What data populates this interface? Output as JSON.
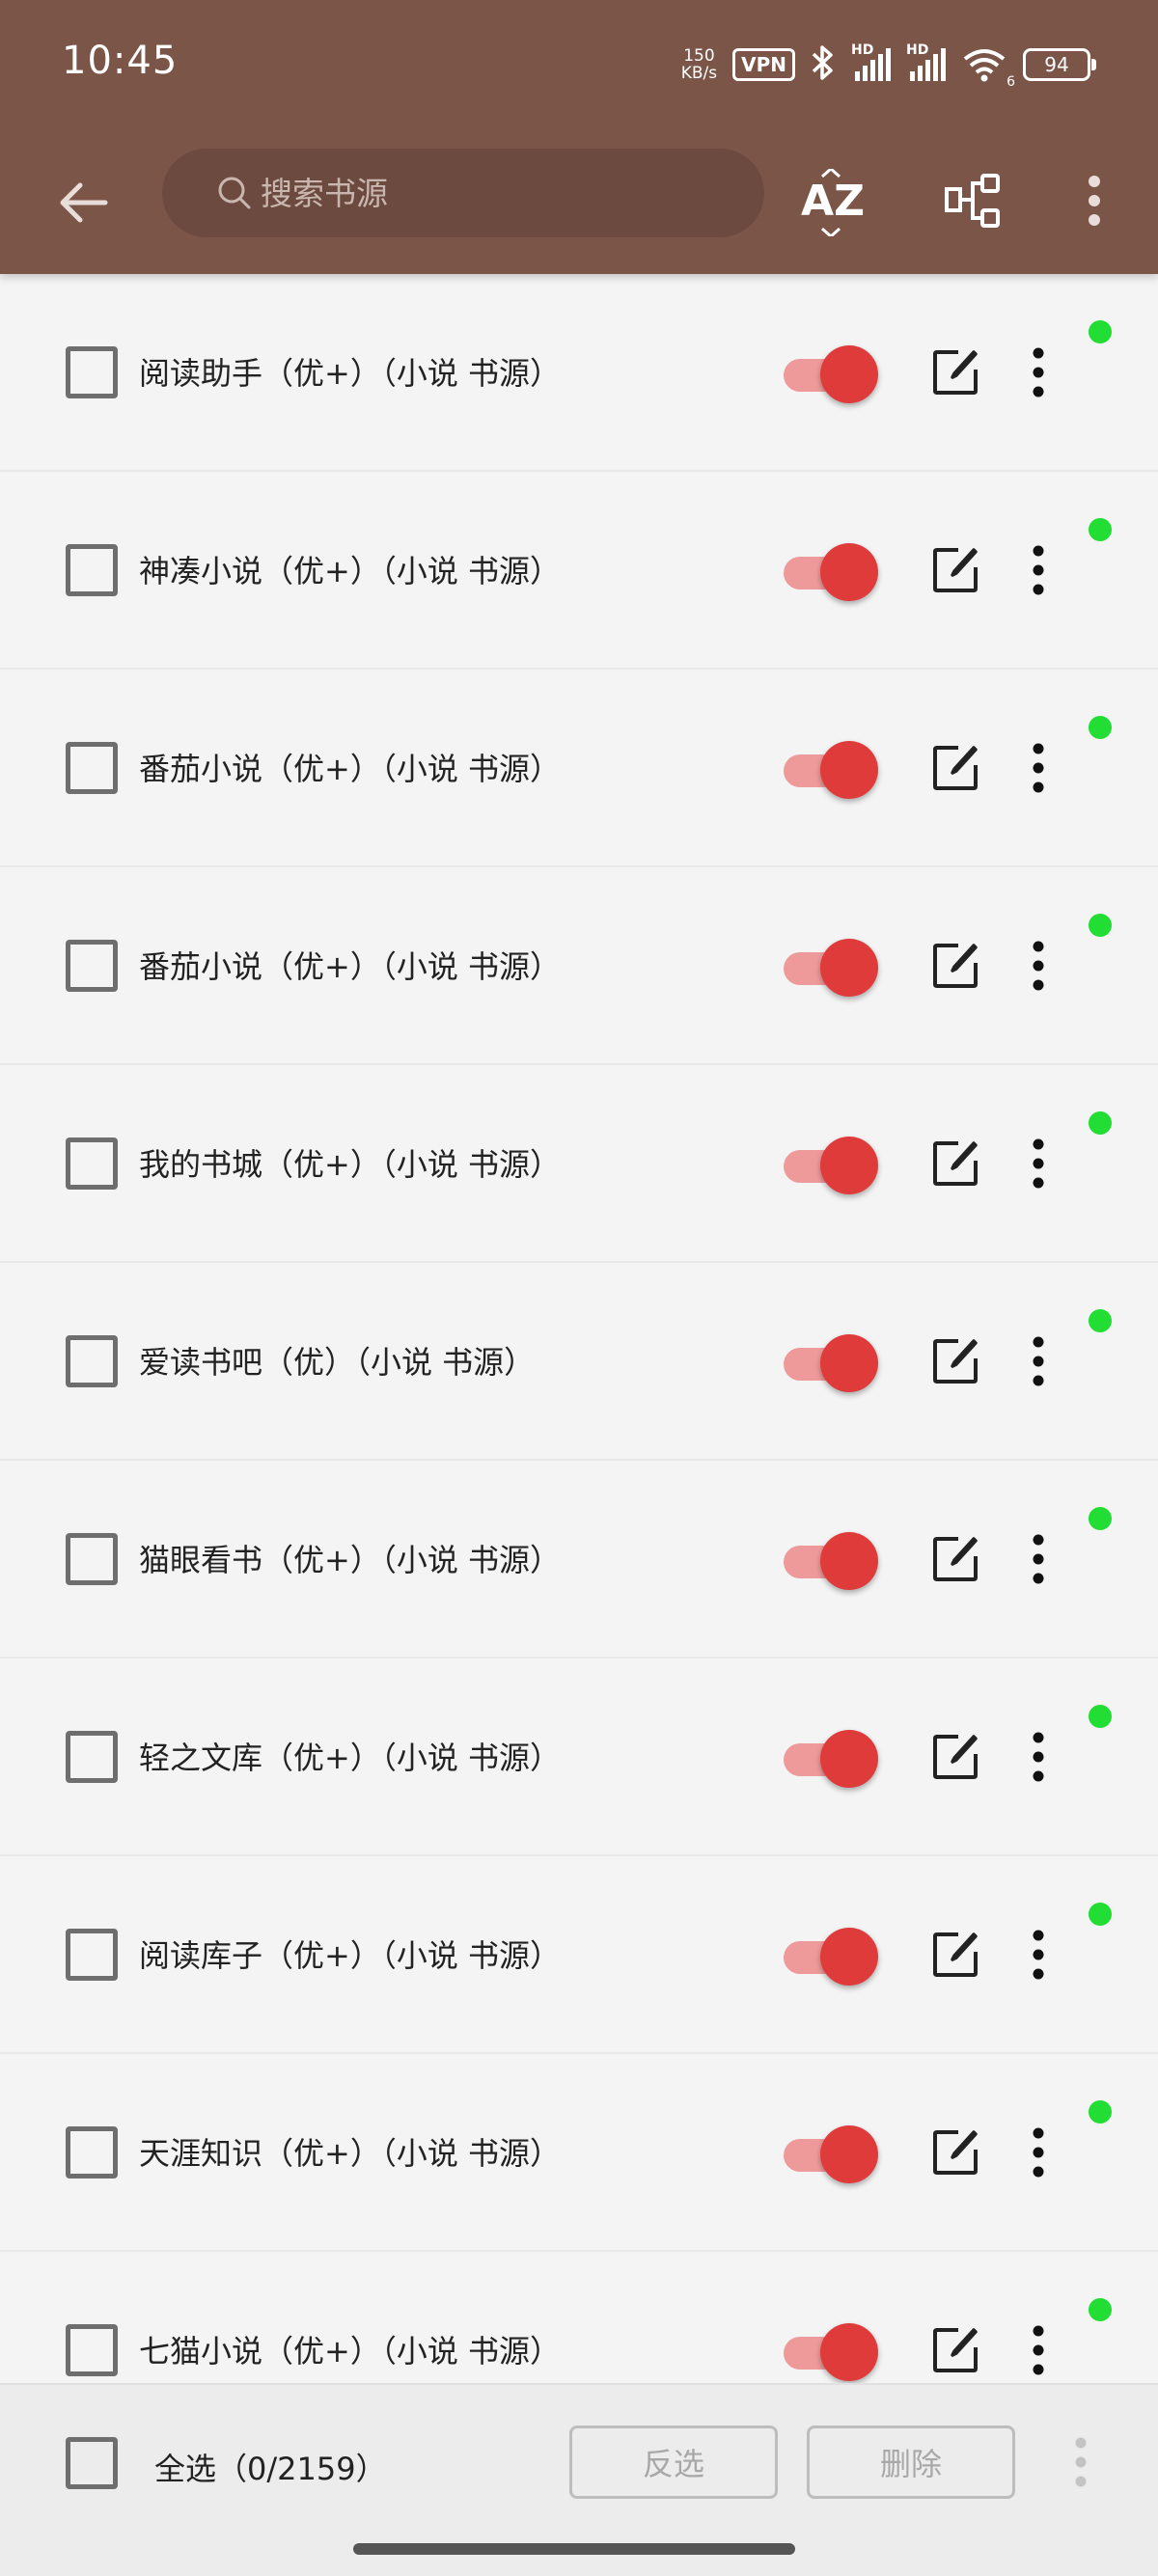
{
  "status_bar": {
    "time": "10:45",
    "net_speed_value": "150",
    "net_speed_unit": "KB/s",
    "vpn": "VPN",
    "hd_1": "HD",
    "hd_2": "HD",
    "wifi_sub": "6",
    "battery": "94"
  },
  "toolbar": {
    "search_placeholder": "搜索书源",
    "sort_icon_label": "AZ"
  },
  "sources": [
    {
      "name": "阅读助手（优+）（小说 书源）",
      "enabled": true
    },
    {
      "name": "神凑小说（优+）（小说 书源）",
      "enabled": true
    },
    {
      "name": "番茄小说（优+）（小说 书源）",
      "enabled": true
    },
    {
      "name": "番茄小说（优+）（小说 书源）",
      "enabled": true
    },
    {
      "name": "我的书城（优+）（小说 书源）",
      "enabled": true
    },
    {
      "name": "爱读书吧（优）（小说 书源）",
      "enabled": true
    },
    {
      "name": "猫眼看书（优+）（小说 书源）",
      "enabled": true
    },
    {
      "name": "轻之文库（优+）（小说 书源）",
      "enabled": true
    },
    {
      "name": "阅读库子（优+）（小说 书源）",
      "enabled": true
    },
    {
      "name": "天涯知识（优+）（小说 书源）",
      "enabled": true
    },
    {
      "name": "七猫小说（优+）（小说 书源）",
      "enabled": true
    }
  ],
  "bottom_bar": {
    "select_all_label": "全选（0/2159）",
    "invert_label": "反选",
    "delete_label": "删除"
  },
  "colors": {
    "header": "#7a5548",
    "accent": "#e03b3b",
    "status_dot": "#22dd33"
  }
}
